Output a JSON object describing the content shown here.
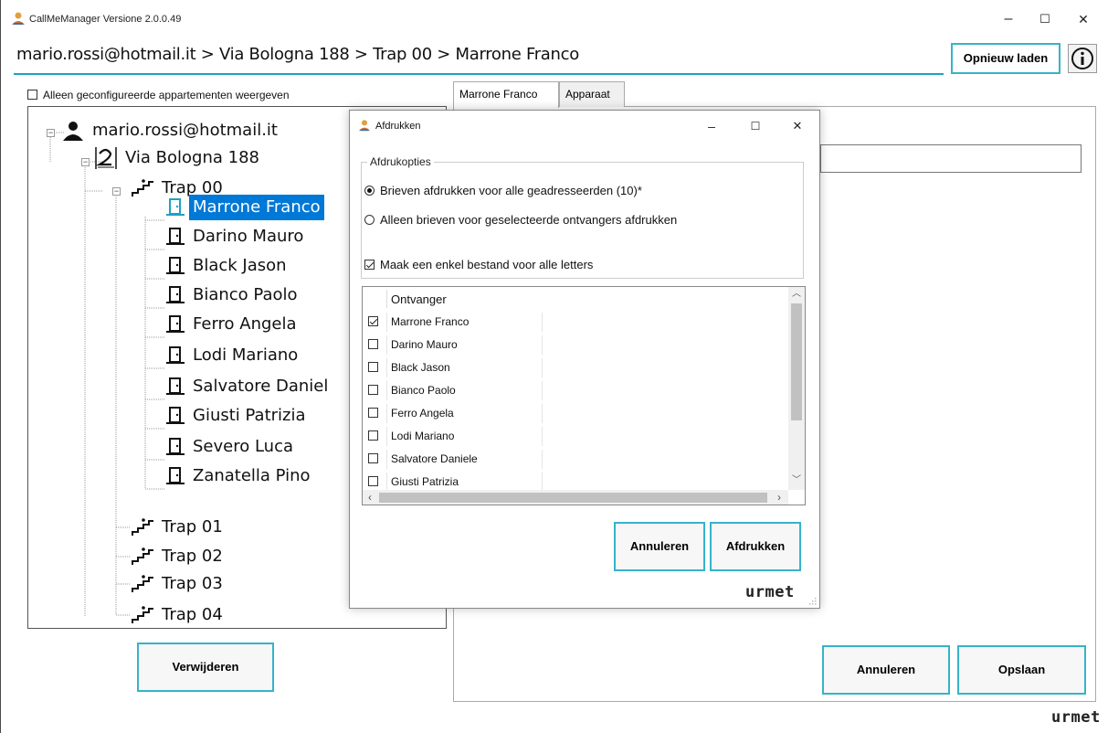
{
  "window": {
    "title": "CallMeManager Versione 2.0.0.49",
    "minimize": "–",
    "maximize": "☐",
    "close": "✕"
  },
  "breadcrumb": "mario.rossi@hotmail.it > Via Bologna 188 > Trap 00 > Marrone Franco",
  "toolbar": {
    "reload_label": "Opnieuw laden",
    "info_icon": "info-icon"
  },
  "left": {
    "filter_label": "Alleen geconfigureerde appartementen weergeven",
    "filter_checked": false,
    "tree": {
      "account": "mario.rossi@hotmail.it",
      "building": "Via Bologna 188",
      "stairs_open": "Trap 00",
      "apartments": [
        "Marrone Franco",
        "Darino Mauro",
        "Black Jason",
        "Bianco Paolo",
        "Ferro Angela",
        "Lodi Mariano",
        "Salvatore Daniel",
        "Giusti Patrizia",
        "Severo Luca",
        "Zanatella Pino"
      ],
      "selected": "Marrone Franco",
      "other_stairs": [
        "Trap 01",
        "Trap 02",
        "Trap 03",
        "Trap 04"
      ]
    },
    "delete_label": "Verwijderen"
  },
  "right": {
    "tabs": [
      "Marrone Franco",
      "Apparaat"
    ],
    "active_tab": "Marrone Franco",
    "cancel_label": "Annuleren",
    "save_label": "Opslaan"
  },
  "brand": "urmet",
  "dialog": {
    "title": "Afdrukken",
    "minimize": "–",
    "maximize": "☐",
    "close": "✕",
    "group_label": "Afdrukopties",
    "option_all": "Brieven afdrukken voor alle geadresseerden (10)*",
    "option_selected": "Alleen brieven voor geselecteerde ontvangers afdrukken",
    "selected_option": "all",
    "single_file_label": "Maak een enkel bestand voor alle letters",
    "single_file_checked": true,
    "list_header": "Ontvanger",
    "recipients": [
      {
        "name": "Marrone Franco",
        "checked": true
      },
      {
        "name": "Darino Mauro",
        "checked": false
      },
      {
        "name": "Black Jason",
        "checked": false
      },
      {
        "name": "Bianco Paolo",
        "checked": false
      },
      {
        "name": "Ferro Angela",
        "checked": false
      },
      {
        "name": "Lodi Mariano",
        "checked": false
      },
      {
        "name": "Salvatore Daniele",
        "checked": false
      },
      {
        "name": "Giusti Patrizia",
        "checked": false
      }
    ],
    "cancel_label": "Annuleren",
    "print_label": "Afdrukken"
  },
  "colors": {
    "accent": "#36b3c9",
    "selection": "#0078d7",
    "breadcrumb_line": "#1aa3c2"
  }
}
